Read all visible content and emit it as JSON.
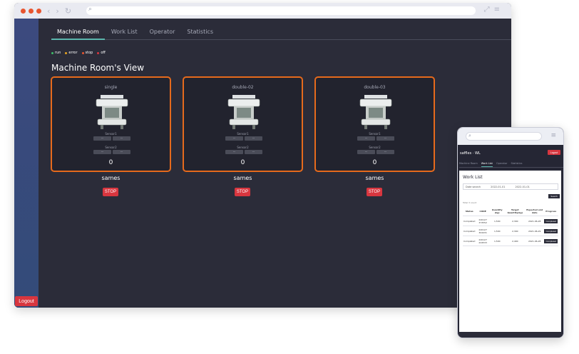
{
  "desktop": {
    "nav_back": "‹",
    "nav_forward": "›",
    "nav_refresh": "↻",
    "search_glyph": "⌕",
    "expand_glyph": "⤢",
    "menu_glyph": "≡",
    "tabs": [
      "Machine Room",
      "Work List",
      "Operator",
      "Statistics"
    ],
    "active_tab": "Machine Room",
    "legend": [
      {
        "label": "run",
        "color": "#3dbd68"
      },
      {
        "label": "error",
        "color": "#e8a420"
      },
      {
        "label": "stop",
        "color": "#e8552f"
      },
      {
        "label": "off",
        "color": "#d8363f"
      }
    ],
    "view_title": "Machine Room's View",
    "machines": [
      {
        "title": "single",
        "sensor1_label": "Sensor1",
        "sensor2_label": "Sensor2",
        "sensor_value": "--",
        "count": "0",
        "name": "sames",
        "stop_label": "STOP"
      },
      {
        "title": "double-02",
        "sensor1_label": "Sensor1",
        "sensor2_label": "Sensor2",
        "sensor_value": "--",
        "count": "0",
        "name": "sames",
        "stop_label": "STOP"
      },
      {
        "title": "double-03",
        "sensor1_label": "Sensor1",
        "sensor2_label": "Sensor2",
        "sensor_value": "--",
        "count": "0",
        "name": "sames",
        "stop_label": "STOP"
      }
    ],
    "logout_label": "Logout",
    "colors": {
      "accent": "#e66a1c",
      "stop": "#d8363f",
      "tab_underline": "#5bb6ad",
      "background": "#2b2c39",
      "sidebar": "#3c4a7e"
    }
  },
  "mobile": {
    "search_glyph": "⌕",
    "menu_glyph": "≡",
    "brand": "saffles · WL",
    "logout_label": "Logout",
    "tabs": [
      "Machine Room",
      "Work List",
      "Operator",
      "Statistics"
    ],
    "active_tab": "Work List",
    "work_list_title": "Work List",
    "date_search_label": "Date search",
    "date_from": "2022-01-01",
    "date_to": "2022-01-01",
    "search_label": "Search",
    "total_label": "Total 3 count",
    "table_headers": [
      "Status",
      "CODE",
      "Quantity (kg)",
      "Target Quantity(kg)",
      "Expected end date",
      "Progress"
    ],
    "table_rows": [
      {
        "status": "Completed",
        "code": "220127 373552",
        "quantity": "1,500",
        "target": "2,300",
        "end_date": "2021-06-28",
        "progress": "Completed"
      },
      {
        "status": "Completed",
        "code": "220127 304431",
        "quantity": "1,500",
        "target": "2,300",
        "end_date": "2021-06-29",
        "progress": "Completed"
      },
      {
        "status": "Completed",
        "code": "220127 224533",
        "quantity": "1,500",
        "target": "2,400",
        "end_date": "2021-06-28",
        "progress": "Completed"
      }
    ]
  }
}
